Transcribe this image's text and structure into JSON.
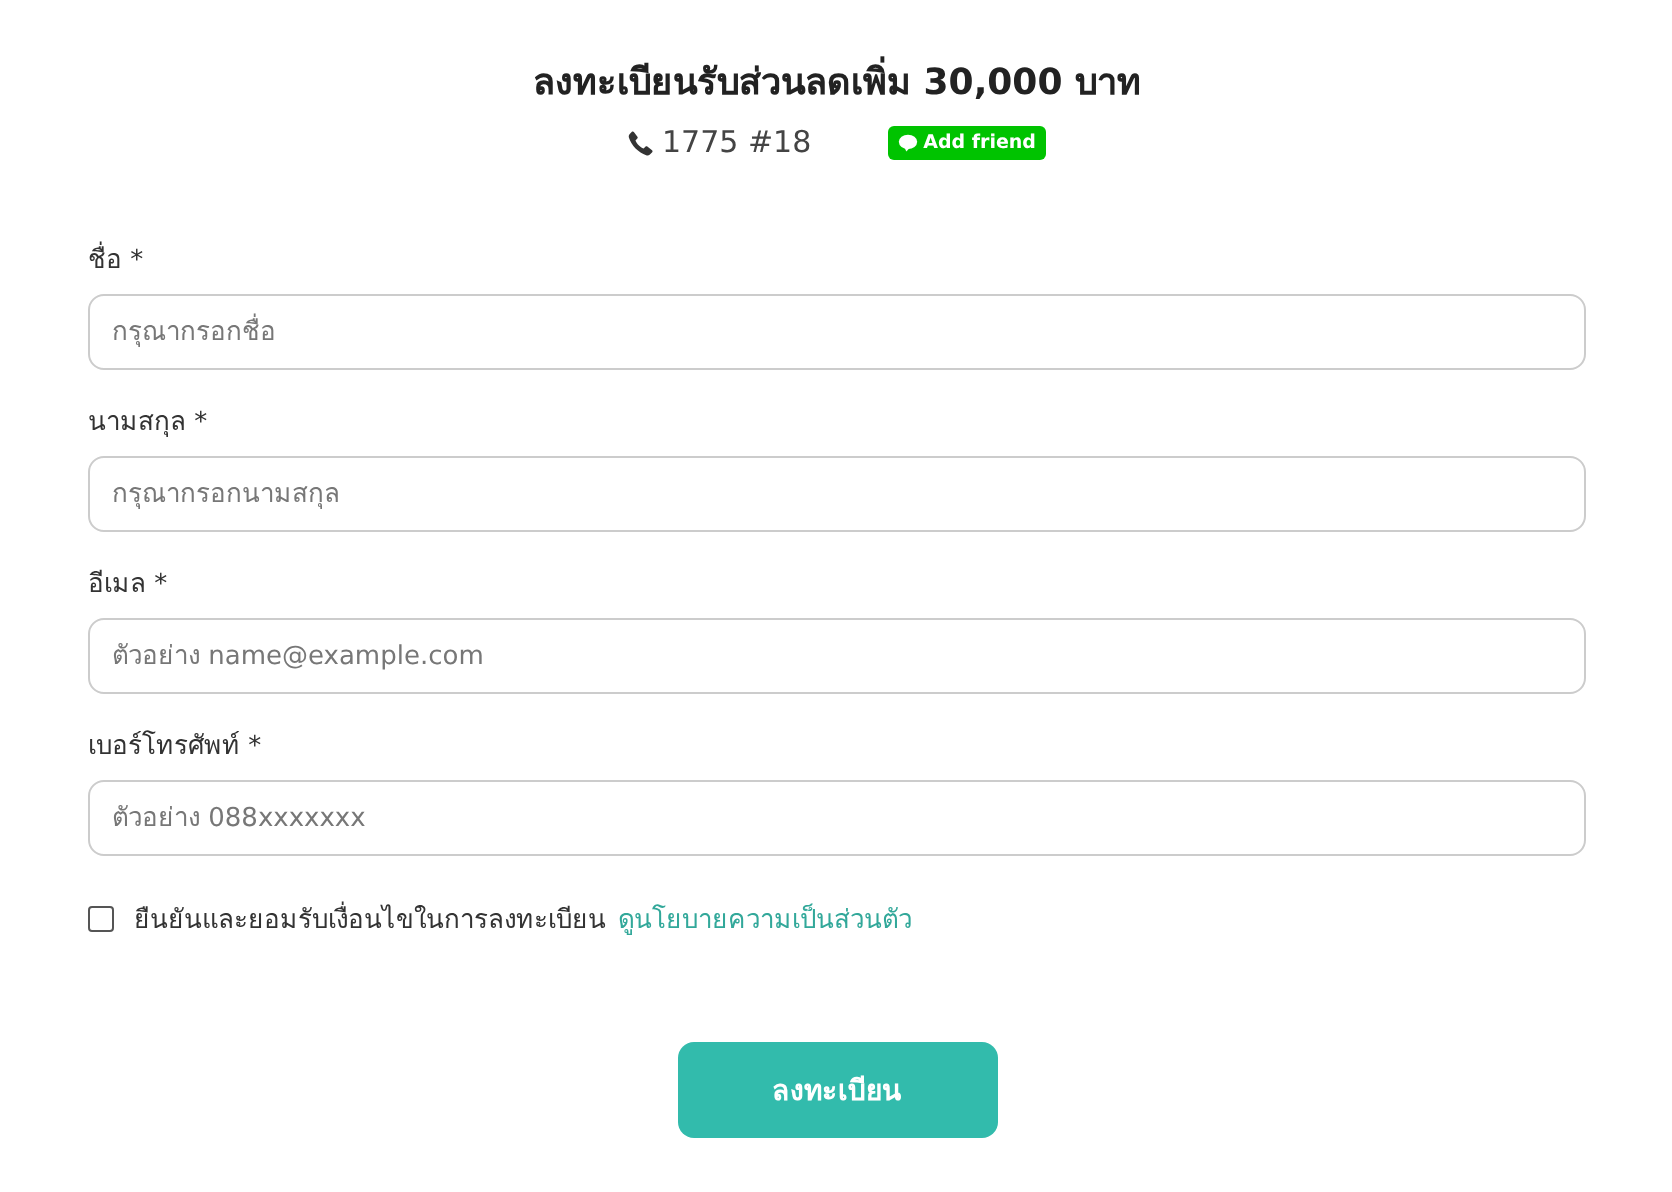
{
  "title": "ลงทะเบียนรับส่วนลดเพิ่ม 30,000 บาท",
  "contact": {
    "phone": "1775 #18",
    "line_button": "Add friend"
  },
  "fields": [
    {
      "label": "ชื่อ *",
      "placeholder": "กรุณากรอกชื่อ"
    },
    {
      "label": "นามสกุล *",
      "placeholder": "กรุณากรอกนามสกุล"
    },
    {
      "label": "อีเมล *",
      "placeholder": "ตัวอย่าง name@example.com"
    },
    {
      "label": "เบอร์โทรศัพท์ *",
      "placeholder": "ตัวอย่าง 088xxxxxxx"
    }
  ],
  "consent": {
    "checked": false,
    "text": "ยืนยันและยอมรับเงื่อนไขในการลงทะเบียน",
    "link": "ดูนโยบายความเป็นส่วนตัว"
  },
  "submit": "ลงทะเบียน"
}
